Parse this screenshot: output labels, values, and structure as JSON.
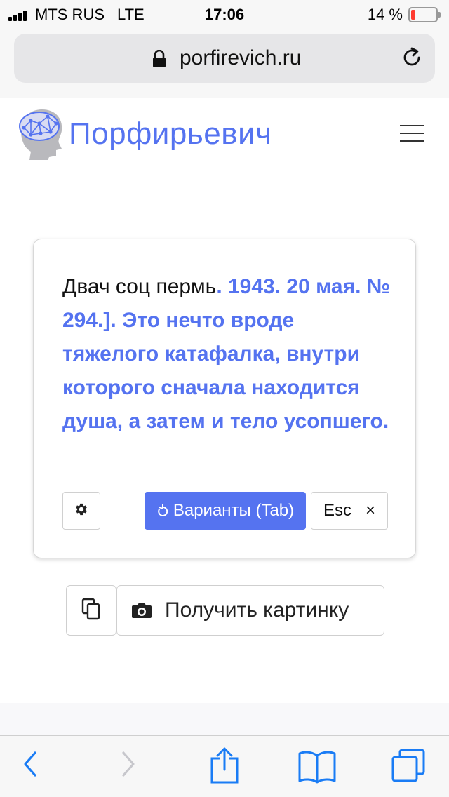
{
  "status_bar": {
    "carrier": "MTS RUS",
    "network": "LTE",
    "time": "17:06",
    "battery": "14 %",
    "battery_level": 0.14
  },
  "browser": {
    "url": "porfirevich.ru"
  },
  "site": {
    "brand": "Порфирьевич"
  },
  "card": {
    "prompt_text": "Двач соц пермь",
    "generated_text": ". 1943. 20 мая. №  294.]. Это нечто вроде тяжелого катафалка, внутри которого сначала находится душа, а затем и тело усопшего.",
    "variants_label": "Варианты (Tab)",
    "esc_label": "Esc",
    "esc_close": "×"
  },
  "actions": {
    "get_picture_label": "Получить картинку"
  },
  "colors": {
    "accent": "#5573f0",
    "ios_blue": "#1a7cf5",
    "ios_blue_disabled": "#c7c7cc"
  }
}
